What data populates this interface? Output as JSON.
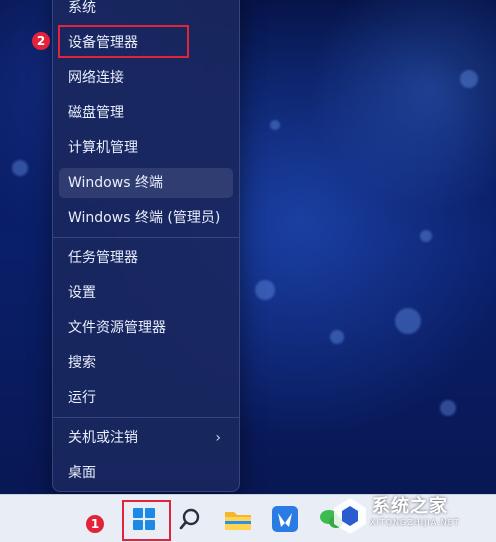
{
  "menu": {
    "items": [
      {
        "label": "系统"
      },
      {
        "label": "设备管理器"
      },
      {
        "label": "网络连接"
      },
      {
        "label": "磁盘管理"
      },
      {
        "label": "计算机管理"
      },
      {
        "label": "Windows 终端"
      },
      {
        "label": "Windows 终端 (管理员)"
      },
      {
        "label": "任务管理器"
      },
      {
        "label": "设置"
      },
      {
        "label": "文件资源管理器"
      },
      {
        "label": "搜索"
      },
      {
        "label": "运行"
      },
      {
        "label": "关机或注销"
      },
      {
        "label": "桌面"
      }
    ],
    "submenu_indicator": "›"
  },
  "annotations": {
    "step1": "1",
    "step2": "2",
    "highlight_color": "#e2233a"
  },
  "taskbar": {
    "icons": [
      "windows-start-icon",
      "search-icon",
      "file-explorer-icon",
      "pinned-app-icon",
      "wechat-icon"
    ]
  },
  "watermark": {
    "title": "系统之家",
    "url": "XITONGZHIJIA.NET"
  }
}
